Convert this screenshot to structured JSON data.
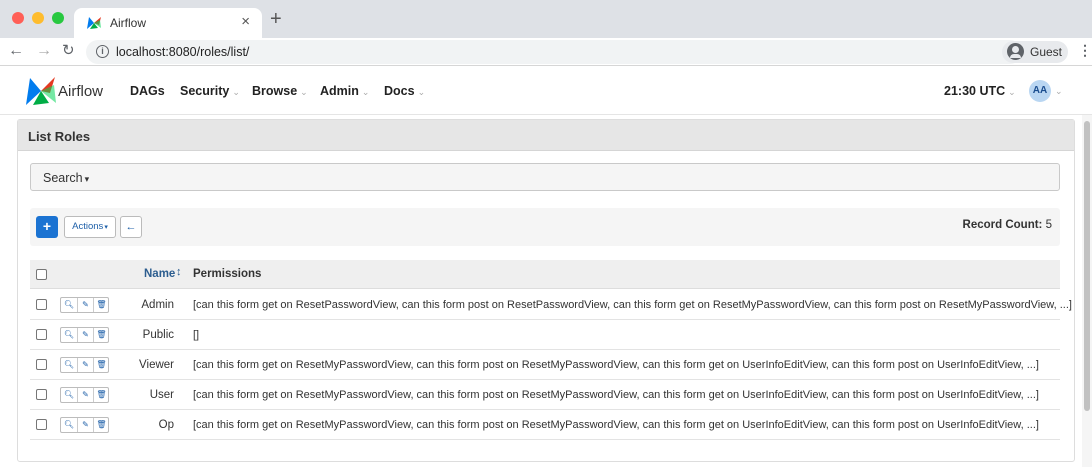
{
  "browser": {
    "tab_title": "Airflow",
    "tab_close": "×",
    "new_tab": "+",
    "url": "localhost:8080/roles/list/",
    "info_glyph": "i",
    "profile_label": "Guest",
    "traffic_lights": [
      "#ff5f57",
      "#febc2e",
      "#28c840"
    ]
  },
  "app": {
    "brand": "Airflow",
    "menu": [
      {
        "label": "DAGs",
        "has_caret": false
      },
      {
        "label": "Security",
        "has_caret": true
      },
      {
        "label": "Browse",
        "has_caret": true
      },
      {
        "label": "Admin",
        "has_caret": true
      },
      {
        "label": "Docs",
        "has_caret": true
      }
    ],
    "clock": "21:30 UTC",
    "user_initials": "AA",
    "accent": "#1b73d2"
  },
  "page": {
    "title": "List Roles",
    "search_label": "Search",
    "add_label": "+",
    "actions_label": "Actions",
    "record_count_label": "Record Count:",
    "record_count": "5",
    "columns": {
      "name": "Name",
      "permissions": "Permissions"
    }
  },
  "rows": [
    {
      "name": "Admin",
      "permissions": "[can this form get on ResetPasswordView, can this form post on ResetPasswordView, can this form get on ResetMyPasswordView, can this form post on ResetMyPasswordView, ...]"
    },
    {
      "name": "Public",
      "permissions": "[]"
    },
    {
      "name": "Viewer",
      "permissions": "[can this form get on ResetMyPasswordView, can this form post on ResetMyPasswordView, can this form get on UserInfoEditView, can this form post on UserInfoEditView, ...]"
    },
    {
      "name": "User",
      "permissions": "[can this form get on ResetMyPasswordView, can this form post on ResetMyPasswordView, can this form get on UserInfoEditView, can this form post on UserInfoEditView, ...]"
    },
    {
      "name": "Op",
      "permissions": "[can this form get on ResetMyPasswordView, can this form post on ResetMyPasswordView, can this form get on UserInfoEditView, can this form post on UserInfoEditView, ...]"
    }
  ]
}
